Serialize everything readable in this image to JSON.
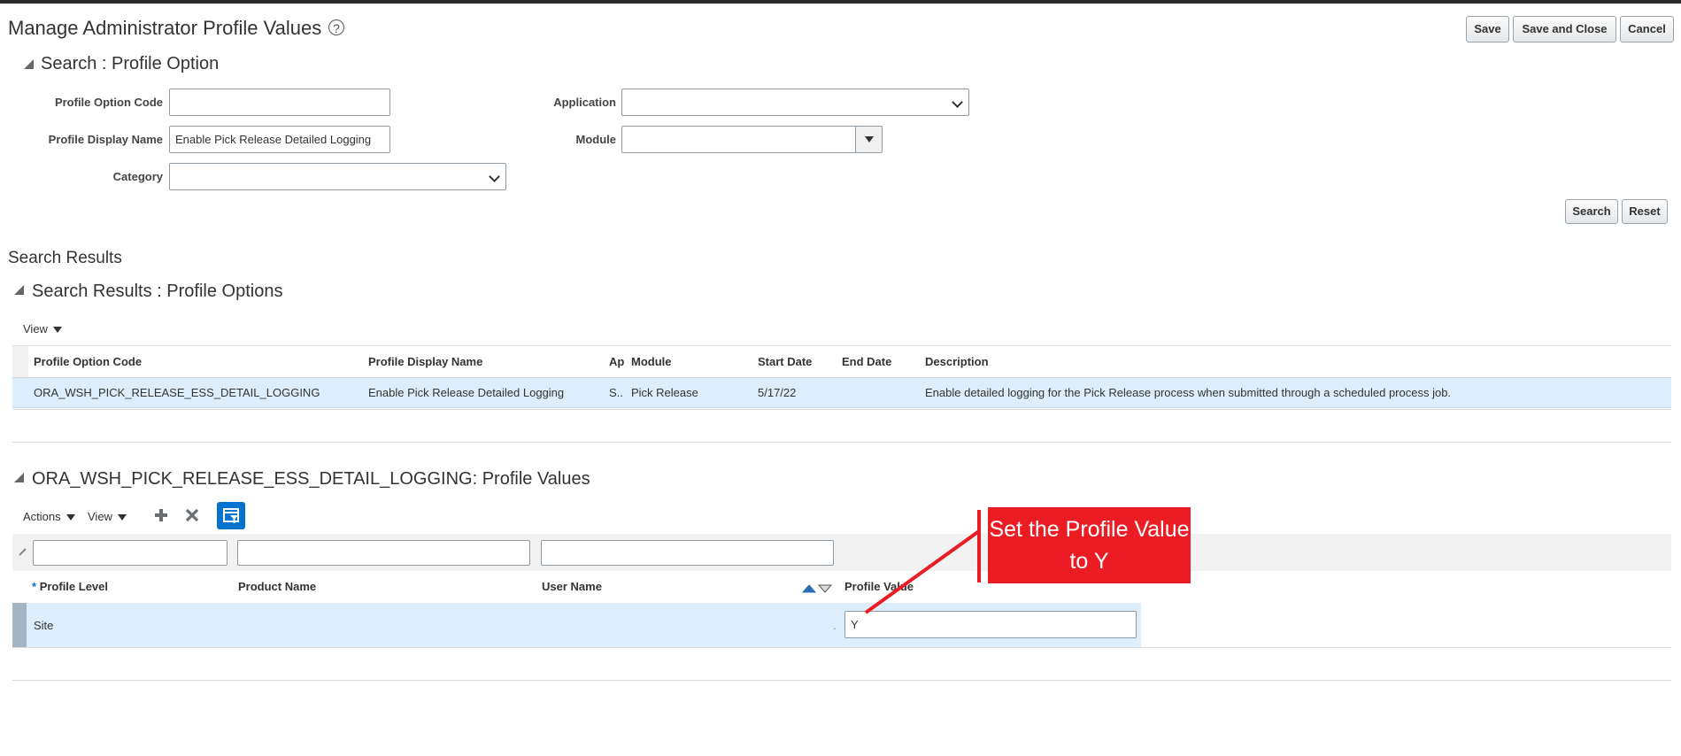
{
  "page": {
    "title": "Manage Administrator Profile Values",
    "help_icon": "help-circle-icon",
    "buttons": {
      "save": "Save",
      "save_close": "Save and Close",
      "cancel": "Cancel"
    }
  },
  "search": {
    "section_title": "Search : Profile Option",
    "fields": {
      "profile_option_code": {
        "label": "Profile Option Code",
        "value": ""
      },
      "profile_display_name": {
        "label": "Profile Display Name",
        "value": "Enable Pick Release Detailed Logging"
      },
      "category": {
        "label": "Category",
        "value": ""
      },
      "application": {
        "label": "Application",
        "value": ""
      },
      "module": {
        "label": "Module",
        "value": ""
      }
    },
    "search_button": "Search",
    "reset_button": "Reset"
  },
  "results": {
    "heading": "Search Results",
    "section_title": "Search Results : Profile Options",
    "view_menu": "View",
    "columns": [
      "Profile Option Code",
      "Profile Display Name",
      "Ap",
      "Module",
      "Start Date",
      "End Date",
      "Description"
    ],
    "rows": [
      {
        "code": "ORA_WSH_PICK_RELEASE_ESS_DETAIL_LOGGING",
        "display_name": "Enable Pick Release Detailed Logging",
        "application": "S..",
        "module": "Pick Release",
        "start_date": "5/17/22",
        "end_date": "",
        "description": "Enable detailed logging for the Pick Release process when submitted through a scheduled process job."
      }
    ]
  },
  "values": {
    "section_title": "ORA_WSH_PICK_RELEASE_ESS_DETAIL_LOGGING: Profile Values",
    "actions_menu": "Actions",
    "view_menu": "View",
    "columns": {
      "level": "Profile Level",
      "product": "Product Name",
      "user": "User Name",
      "value": "Profile Value"
    },
    "rows": [
      {
        "level": "Site",
        "product": "",
        "user": "",
        "dot": ".",
        "value": "Y"
      }
    ]
  },
  "callout": {
    "text": "Set the Profile Value to Y",
    "color": "#ec1c24"
  }
}
